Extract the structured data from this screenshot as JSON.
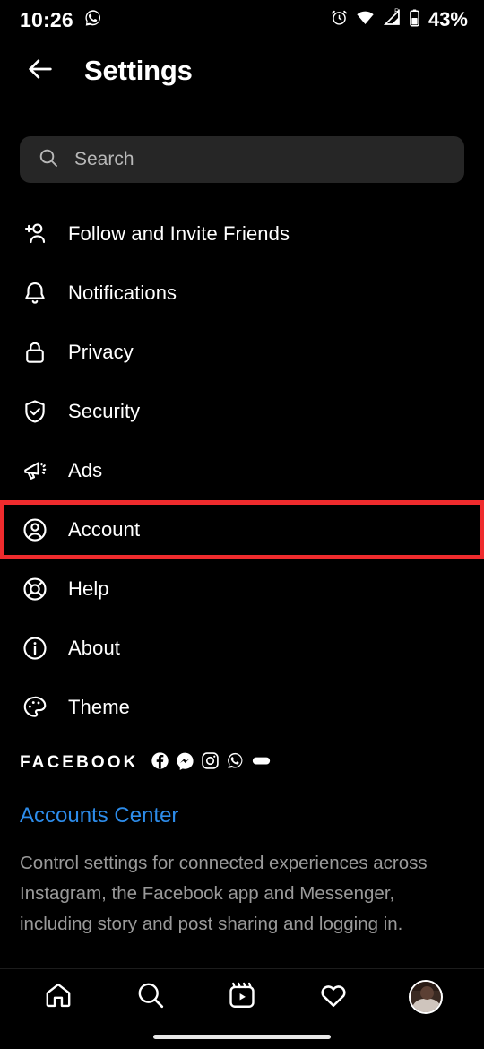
{
  "status_bar": {
    "time": "10:26",
    "notification_icon": "whatsapp-icon",
    "icons": [
      "alarm-icon",
      "wifi-icon",
      "signal-icon",
      "battery-icon"
    ],
    "battery_percent": "43%"
  },
  "header": {
    "back_icon": "back-arrow-icon",
    "title": "Settings"
  },
  "search": {
    "icon": "search-icon",
    "placeholder": "Search",
    "value": ""
  },
  "menu": {
    "items": [
      {
        "label": "Follow and Invite Friends",
        "icon": "person-add-icon",
        "highlighted": false
      },
      {
        "label": "Notifications",
        "icon": "bell-icon",
        "highlighted": false
      },
      {
        "label": "Privacy",
        "icon": "lock-icon",
        "highlighted": false
      },
      {
        "label": "Security",
        "icon": "shield-check-icon",
        "highlighted": false
      },
      {
        "label": "Ads",
        "icon": "megaphone-icon",
        "highlighted": false
      },
      {
        "label": "Account",
        "icon": "account-circle-icon",
        "highlighted": true
      },
      {
        "label": "Help",
        "icon": "lifebuoy-icon",
        "highlighted": false
      },
      {
        "label": "About",
        "icon": "info-circle-icon",
        "highlighted": false
      },
      {
        "label": "Theme",
        "icon": "palette-icon",
        "highlighted": false
      }
    ]
  },
  "facebook_section": {
    "heading": "FACEBOOK",
    "app_icons": [
      "facebook-icon",
      "messenger-icon",
      "instagram-icon",
      "whatsapp-icon",
      "portal-icon"
    ],
    "link": "Accounts Center",
    "description": "Control settings for connected experiences across Instagram, the Facebook app and Messenger, including story and post sharing and logging in."
  },
  "bottom_nav": {
    "items": [
      {
        "name": "home-icon",
        "label": "Home"
      },
      {
        "name": "search-icon",
        "label": "Search"
      },
      {
        "name": "reels-icon",
        "label": "Reels"
      },
      {
        "name": "heart-icon",
        "label": "Activity"
      },
      {
        "name": "profile-avatar",
        "label": "Profile"
      }
    ]
  },
  "colors": {
    "background": "#000000",
    "highlight_red": "#ef2b2d",
    "link_blue": "#2d8cea",
    "search_field": "#262626",
    "secondary_text": "#9a9a9a"
  }
}
